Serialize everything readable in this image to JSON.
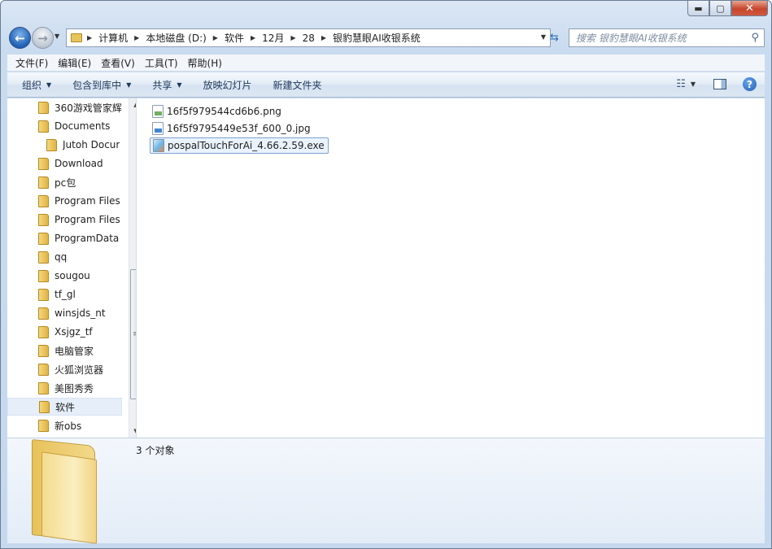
{
  "window": {
    "caption_buttons": {
      "minimize": "▬",
      "maximize": "▢",
      "close": "✕"
    }
  },
  "address": {
    "crumbs": [
      "计算机",
      "本地磁盘 (D:)",
      "软件",
      "12月",
      "28",
      "银豹慧眼AI收银系统"
    ],
    "search_placeholder": "搜索 银豹慧眼AI收银系统",
    "search_icon": "magnifier-icon"
  },
  "menu": [
    "文件(F)",
    "编辑(E)",
    "查看(V)",
    "工具(T)",
    "帮助(H)"
  ],
  "toolbar": {
    "organize": "组织",
    "include_in_library": "包含到库中",
    "share": "共享",
    "slideshow": "放映幻灯片",
    "new_folder": "新建文件夹"
  },
  "nav_tree": [
    "360游戏管家辉",
    "Documents",
    "Jutoh Docur",
    "Download",
    "pc包",
    "Program Files",
    "Program Files",
    "ProgramData",
    "qq",
    "sougou",
    "tf_gl",
    "winsjds_nt",
    "Xsjgz_tf",
    "电脑管家",
    "火狐浏览器",
    "美图秀秀",
    "软件",
    "新obs"
  ],
  "nav_selected": "软件",
  "files": [
    {
      "name": "16f5f979544cd6b6.png",
      "type": "png"
    },
    {
      "name": "16f5f9795449e53f_600_0.jpg",
      "type": "jpg"
    },
    {
      "name": "pospalTouchForAi_4.66.2.59.exe",
      "type": "exe"
    }
  ],
  "details": {
    "count": "3 个对象"
  }
}
